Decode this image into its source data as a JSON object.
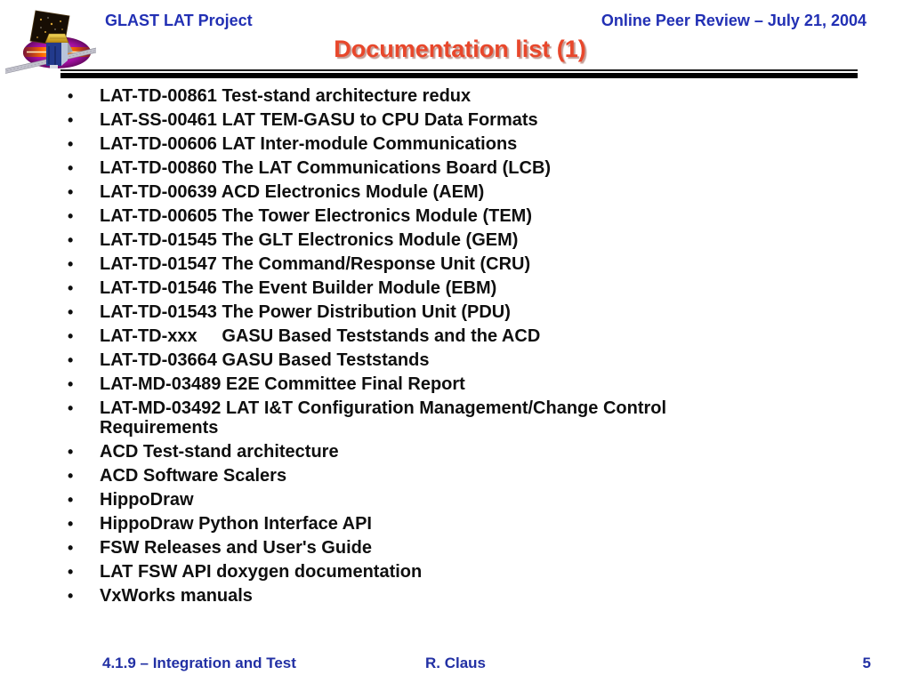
{
  "header": {
    "project": "GLAST LAT Project",
    "review": "Online Peer Review – July 21, 2004"
  },
  "title": "Documentation list (1)",
  "list": {
    "items": [
      "LAT-TD-00861 Test-stand architecture redux",
      "LAT-SS-00461 LAT TEM-GASU to CPU Data Formats",
      "LAT-TD-00606 LAT Inter-module Communications",
      "LAT-TD-00860 The LAT Communications Board (LCB)",
      "LAT-TD-00639 ACD Electronics Module (AEM)",
      "LAT-TD-00605 The Tower Electronics Module (TEM)",
      "LAT-TD-01545 The GLT Electronics Module (GEM)",
      "LAT-TD-01547 The Command/Response Unit (CRU)",
      "LAT-TD-01546 The Event Builder Module (EBM)",
      "LAT-TD-01543 The Power Distribution Unit (PDU)",
      "LAT-TD-xxx     GASU Based Teststands and the ACD",
      "LAT-TD-03664 GASU Based Teststands",
      "LAT-MD-03489 E2E Committee Final Report",
      "LAT-MD-03492 LAT I&T Configuration Management/Change Control Requirements",
      "ACD Test-stand architecture",
      "ACD Software Scalers",
      "HippoDraw",
      "HippoDraw Python Interface API",
      "FSW Releases and User's Guide",
      "LAT FSW API doxygen documentation",
      "VxWorks manuals"
    ]
  },
  "footer": {
    "left": "4.1.9 – Integration and Test",
    "center": "R. Claus",
    "page": "5"
  },
  "colors": {
    "header_blue": "#2230b4",
    "title_red": "#e8472b",
    "body_text": "#0f0f0f",
    "footer_blue": "#2230a4",
    "rule_black": "#000000"
  },
  "icons": {
    "logo": "glast-satellite-logo"
  }
}
